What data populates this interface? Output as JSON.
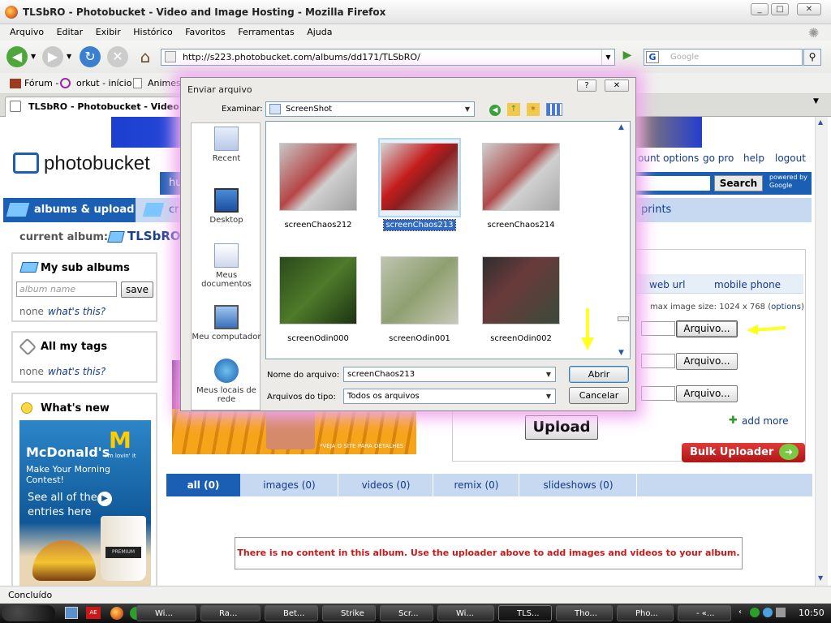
{
  "window": {
    "title": "TLSbRO - Photobucket - Video and Image Hosting - Mozilla Firefox",
    "controls": {
      "minimize": "_",
      "maximize": "□",
      "close": "✕"
    }
  },
  "menu": [
    "Arquivo",
    "Editar",
    "Exibir",
    "Histórico",
    "Favoritos",
    "Ferramentas",
    "Ajuda"
  ],
  "nav": {
    "url": "http://s223.photobucket.com/albums/dd171/TLSbRO/",
    "search_placeholder": "Google"
  },
  "bookmarks": [
    "Fórum -",
    "orkut - início",
    "Animes I"
  ],
  "tab": {
    "label": "TLSbRO - Photobucket - Video and ..."
  },
  "photobucket": {
    "logo": "photobucket",
    "account_links": [
      "ount options",
      "go pro",
      "help",
      "logout"
    ],
    "search_button": "Search",
    "powered_by": "powered by Google",
    "main_tab": "albums & upload",
    "cr_tab": "cr",
    "prints_tab": "prints",
    "hu_stub": "hu",
    "current_album_label": "current album:",
    "current_album": "TLSbRO",
    "sub_albums": {
      "title": "My sub albums",
      "placeholder": "album name",
      "save": "save",
      "none": "none",
      "whats_this": "what's this?"
    },
    "tags": {
      "title": "All my tags",
      "none": "none",
      "whats_this": "what's this?"
    },
    "whats_new": {
      "title": "What's new"
    },
    "ad": {
      "brand": "McDonald's",
      "slogan": "i'm lovin' it",
      "line1": "Make Your Morning Contest!",
      "line2": "See all of the",
      "line3": "entries here",
      "badge": "PREMIUM"
    },
    "upload_tabs": [
      "web url",
      "mobile phone"
    ],
    "max_size": "max image size: 1024 x 768 (",
    "options": "options",
    "max_size_close": ")",
    "arquivo_buttons": [
      "Arquivo...",
      "Arquivo...",
      "Arquivo..."
    ],
    "upload_button": "Upload",
    "add_more": "add more",
    "bulk": "Bulk Uploader",
    "banner_note": "*VEJA O SITE PARA DETALHES",
    "filter_tabs": [
      "all (0)",
      "images (0)",
      "videos (0)",
      "remix (0)",
      "slideshows (0)"
    ],
    "empty_message": "There is no content in this album. Use the uploader above to add images and videos to your album."
  },
  "dialog": {
    "title": "Enviar arquivo",
    "help": "?",
    "close": "✕",
    "look_in_label": "Examinar:",
    "look_in_value": "ScreenShot",
    "places": [
      "Recent",
      "Desktop",
      "Meus documentos",
      "Meu computador",
      "Meus locais de rede"
    ],
    "files": [
      {
        "name": "screenChaos212",
        "selected": false
      },
      {
        "name": "screenChaos213",
        "selected": true
      },
      {
        "name": "screenChaos214",
        "selected": false
      },
      {
        "name": "screenOdin000",
        "selected": false
      },
      {
        "name": "screenOdin001",
        "selected": false
      },
      {
        "name": "screenOdin002",
        "selected": false
      }
    ],
    "filename_label": "Nome do arquivo:",
    "filename_value": "screenChaos213",
    "filetype_label": "Arquivos do tipo:",
    "filetype_value": "Todos os arquivos",
    "open": "Abrir",
    "cancel": "Cancelar"
  },
  "status": "Concluído",
  "taskbar": {
    "items": [
      "Wi...",
      "Ra...",
      "Bet...",
      "Strike",
      "Scr...",
      "Wi...",
      "TLS...",
      "Tho...",
      "Pho...",
      "- «..."
    ],
    "clock": "10:50"
  },
  "colors": {
    "pb_blue": "#1a5fb4",
    "accent_red": "#c81818",
    "link": "#113a8b",
    "selection": "#316ac5",
    "annotation_arrow": "#ffff22"
  }
}
